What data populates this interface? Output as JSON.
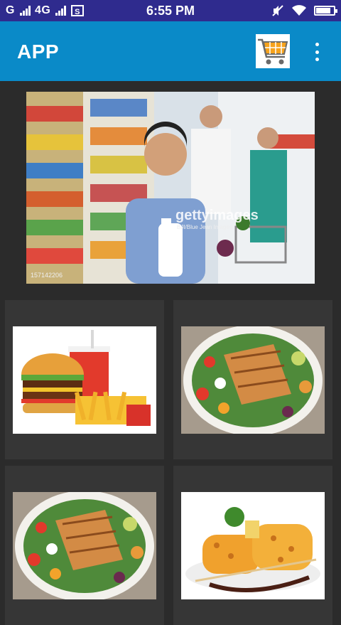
{
  "status_bar": {
    "carrier1": "G",
    "carrier2": "4G",
    "time": "6:55 PM",
    "battery_level": 0.85
  },
  "app_bar": {
    "title": "APP",
    "cart_icon": "shopping-cart-icon",
    "menu_icon": "more-vert-icon"
  },
  "banner": {
    "watermark": "gettyimages",
    "credit": "BJI/Blue Jean Images",
    "code": "157142206"
  },
  "products": [
    {
      "name": "burger-fries"
    },
    {
      "name": "grilled-chicken-salad"
    },
    {
      "name": "grilled-chicken-salad"
    },
    {
      "name": "grilled-corn-plate"
    }
  ],
  "colors": {
    "status_bar": "#2f2b8e",
    "app_bar": "#0a8ac8",
    "background": "#2b2b2b",
    "card": "#363636"
  }
}
